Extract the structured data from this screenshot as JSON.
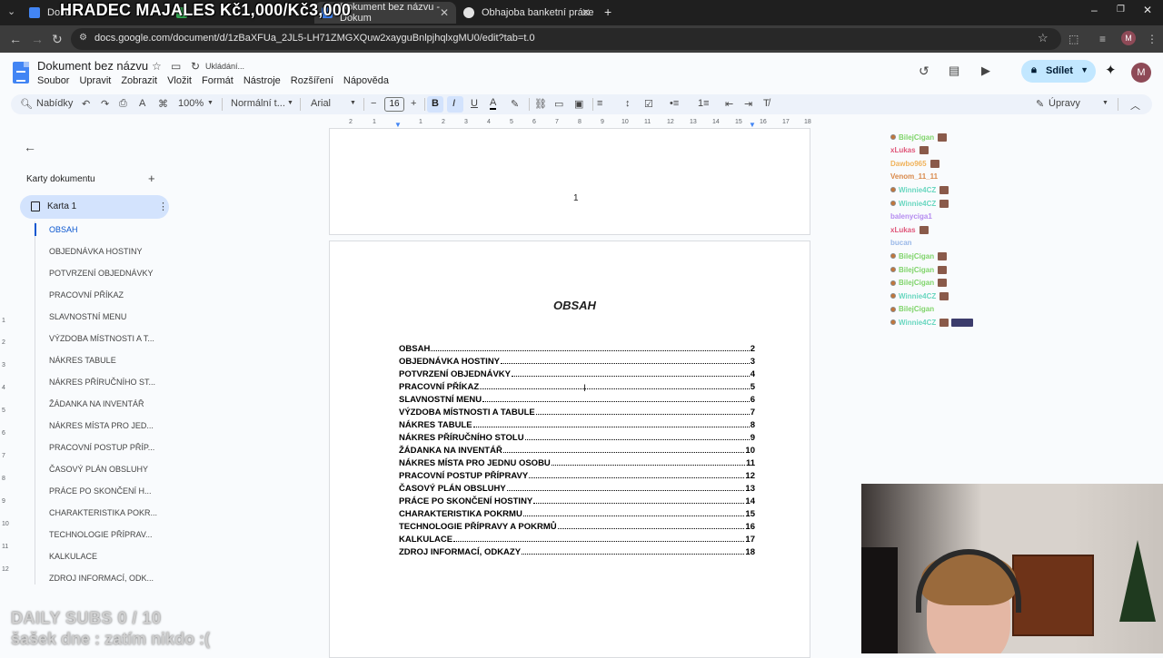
{
  "overlay": {
    "title": "HRADEC MAJALES Kč1,000/Kč3,000",
    "subs": "DAILY SUBS 0 / 10",
    "sasek": "šašek dne : zatím nikdo :("
  },
  "browser": {
    "tabs": [
      {
        "label": "Docu",
        "color": "#4285f4"
      },
      {
        "label": "",
        "color": "#34a853"
      },
      {
        "label": "Dokument bez názvu - Dokum",
        "color": "#4285f4"
      },
      {
        "label": "Obhajoba banketní práce",
        "color": "#e3e3e3"
      }
    ],
    "url": "docs.google.com/document/d/1zBaXFUa_2JL5-LH71ZMGXQuw2xayguBnlpjhqlxgMU0/edit?tab=t.0"
  },
  "docs": {
    "title": "Dokument bez názvu",
    "saving": "Ukládání...",
    "menus": [
      "Soubor",
      "Upravit",
      "Zobrazit",
      "Vložit",
      "Formát",
      "Nástroje",
      "Rozšíření",
      "Nápověda"
    ],
    "share": "Sdílet",
    "avatar": "M",
    "edit_mode": "Úpravy"
  },
  "toolbar": {
    "search": "Nabídky",
    "zoom": "100%",
    "style": "Normální t...",
    "font": "Arial",
    "size": "16"
  },
  "ruler": [
    2,
    1,
    1,
    2,
    3,
    4,
    5,
    6,
    7,
    8,
    9,
    10,
    11,
    12,
    13,
    14,
    15,
    16,
    17,
    18
  ],
  "vruler": [
    1,
    2,
    3,
    4,
    5,
    6,
    7,
    8,
    9,
    10,
    11,
    12
  ],
  "sidebar": {
    "title": "Karty dokumentu",
    "tab": "Karta 1",
    "outline": [
      "OBSAH",
      "OBJEDNÁVKA HOSTINY",
      "POTVRZENÍ OBJEDNÁVKY",
      "PRACOVNÍ PŘÍKAZ",
      "SLAVNOSTNÍ MENU",
      "VÝZDOBA MÍSTNOSTI A T...",
      "NÁKRES TABULE",
      "NÁKRES PŘÍRUČNÍHO ST...",
      "ŽÁDANKA NA INVENTÁŘ",
      "NÁKRES MÍSTA PRO JED...",
      "PRACOVNÍ POSTUP PŘÍP...",
      "ČASOVÝ PLÁN OBSLUHY",
      "PRÁCE PO SKONČENÍ H...",
      "CHARAKTERISTIKA POKR...",
      "TECHNOLOGIE PŘÍPRAV...",
      "KALKULACE",
      "ZDROJ INFORMACÍ, ODK..."
    ]
  },
  "document": {
    "page_number": "1",
    "toc_title": "OBSAH",
    "toc": [
      {
        "title": "OBSAH",
        "page": "2"
      },
      {
        "title": "OBJEDNÁVKA HOSTINY",
        "page": "3"
      },
      {
        "title": "POTVRZENÍ OBJEDNÁVKY",
        "page": "4"
      },
      {
        "title": "PRACOVNÍ PŘÍKAZ",
        "page": "5"
      },
      {
        "title": "SLAVNOSTNÍ MENU",
        "page": "6"
      },
      {
        "title": "VÝZDOBA MÍSTNOSTI A TABULE",
        "page": "7"
      },
      {
        "title": "NÁKRES TABULE",
        "page": "8"
      },
      {
        "title": "NÁKRES PŘÍRUČNÍHO STOLU",
        "page": "9"
      },
      {
        "title": "ŽÁDANKA NA INVENTÁŘ",
        "page": "10"
      },
      {
        "title": "NÁKRES MÍSTA PRO JEDNU OSOBU",
        "page": "11"
      },
      {
        "title": "PRACOVNÍ POSTUP PŘÍPRAVY",
        "page": "12"
      },
      {
        "title": "ČASOVÝ PLÁN OBSLUHY",
        "page": "13"
      },
      {
        "title": "PRÁCE PO SKONČENÍ HOSTINY",
        "page": "14"
      },
      {
        "title": "CHARAKTERISTIKA POKRMU",
        "page": "15"
      },
      {
        "title": "TECHNOLOGIE PŘÍPRAVY A POKRMŮ",
        "page": "16"
      },
      {
        "title": "KALKULACE",
        "page": "17"
      },
      {
        "title": "ZDROJ INFORMACÍ, ODKAZY",
        "page": "18"
      }
    ]
  },
  "chat": [
    {
      "nick": "BilejCigan",
      "color": "#7fd46a",
      "badge": true,
      "emotes": 1
    },
    {
      "nick": "xLukas",
      "color": "#e0577a",
      "badge": false,
      "emotes": 1
    },
    {
      "nick": "Dawbo965",
      "color": "#f0b25a",
      "badge": false,
      "emotes": 1
    },
    {
      "nick": "Venom_11_11",
      "color": "#d9894a",
      "badge": false,
      "emotes": 0
    },
    {
      "nick": "Winnie4CZ",
      "color": "#6ad7c0",
      "badge": true,
      "emotes": 1
    },
    {
      "nick": "Winnie4CZ",
      "color": "#6ad7c0",
      "badge": true,
      "emotes": 1
    },
    {
      "nick": "balenyciga1",
      "color": "#b58cf0",
      "badge": false,
      "emotes": 0
    },
    {
      "nick": "xLukas",
      "color": "#e0577a",
      "badge": false,
      "emotes": 1
    },
    {
      "nick": "bucan",
      "color": "#9ab8e8",
      "badge": false,
      "emotes": 0
    },
    {
      "nick": "BilejCigan",
      "color": "#7fd46a",
      "badge": true,
      "emotes": 1
    },
    {
      "nick": "BilejCigan",
      "color": "#7fd46a",
      "badge": true,
      "emotes": 1
    },
    {
      "nick": "BilejCigan",
      "color": "#7fd46a",
      "badge": true,
      "emotes": 1
    },
    {
      "nick": "Winnie4CZ",
      "color": "#6ad7c0",
      "badge": true,
      "emotes": 1
    },
    {
      "nick": "BilejCigan",
      "color": "#7fd46a",
      "badge": true,
      "emotes": 0
    },
    {
      "nick": "Winnie4CZ",
      "color": "#6ad7c0",
      "badge": true,
      "emotes": 2
    }
  ]
}
